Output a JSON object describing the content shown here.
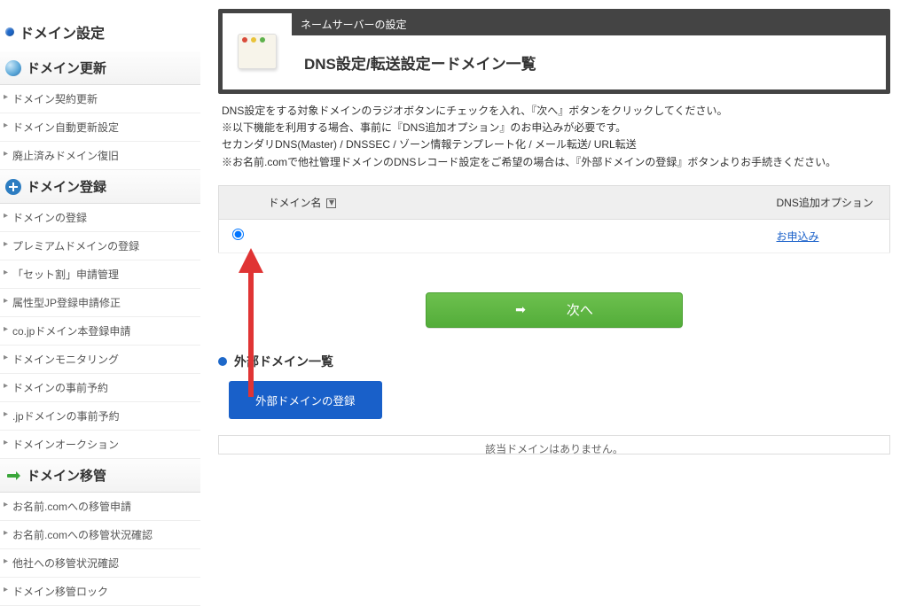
{
  "sidebar": {
    "title": "ドメイン設定",
    "sections": [
      {
        "label": "ドメイン更新",
        "items": [
          "ドメイン契約更新",
          "ドメイン自動更新設定",
          "廃止済みドメイン復旧"
        ]
      },
      {
        "label": "ドメイン登録",
        "items": [
          "ドメインの登録",
          "プレミアムドメインの登録",
          "「セット割」申請管理",
          "属性型JP登録申請修正",
          "co.jpドメイン本登録申請",
          "ドメインモニタリング",
          "ドメインの事前予約",
          ".jpドメインの事前予約",
          "ドメインオークション"
        ]
      },
      {
        "label": "ドメイン移管",
        "items": [
          "お名前.comへの移管申請",
          "お名前.comへの移管状況確認",
          "他社への移管状況確認",
          "ドメイン移管ロック"
        ]
      }
    ]
  },
  "panel": {
    "bar": "ネームサーバーの設定",
    "heading": "DNS設定/転送設定ードメイン一覧"
  },
  "description": {
    "l1": "DNS設定をする対象ドメインのラジオボタンにチェックを入れ、『次へ』ボタンをクリックしてください。",
    "l2": "※以下機能を利用する場合、事前に『DNS追加オプション』のお申込みが必要です。",
    "l3": "セカンダリDNS(Master) / DNSSEC / ゾーン情報テンプレート化 / メール転送/ URL転送",
    "l4": "※お名前.comで他社管理ドメインのDNSレコード設定をご希望の場合は、『外部ドメインの登録』ボタンよりお手続きください。"
  },
  "table": {
    "col_domain": "ドメイン名",
    "col_dnsopt": "DNS追加オプション",
    "rows": [
      {
        "domain_masked": "",
        "apply_label": "お申込み"
      }
    ]
  },
  "next_btn": "次へ",
  "external": {
    "heading": "外部ドメイン一覧",
    "reg_btn": "外部ドメインの登録",
    "empty": "該当ドメインはありません。"
  }
}
